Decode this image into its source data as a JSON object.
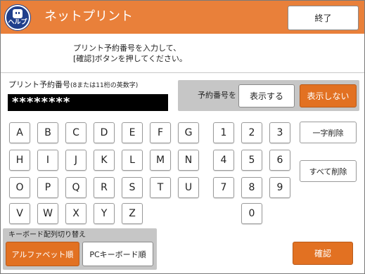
{
  "header": {
    "help_label": "ヘルプ",
    "title": "ネットプリント",
    "end_label": "終了",
    "color": "#e9803a"
  },
  "instructions": {
    "line1": "プリント予約番号を入力して、",
    "line2": "[確認]ボタンを押してください。"
  },
  "number_field": {
    "label": "プリント予約番号",
    "hint": "(8または11桁の英数字)",
    "value": "********"
  },
  "visibility": {
    "label": "予約番号を",
    "show_label": "表示する",
    "hide_label": "表示しない",
    "selected": "表示しない"
  },
  "keys": {
    "letters": [
      "A",
      "B",
      "C",
      "D",
      "E",
      "F",
      "G",
      "H",
      "I",
      "J",
      "K",
      "L",
      "M",
      "N",
      "O",
      "P",
      "Q",
      "R",
      "S",
      "T",
      "U",
      "V",
      "W",
      "X",
      "Y",
      "Z"
    ],
    "digits": [
      "1",
      "2",
      "3",
      "4",
      "5",
      "6",
      "7",
      "8",
      "9",
      "0"
    ]
  },
  "side_buttons": {
    "delete_one": "一字削除",
    "delete_all": "すべて削除"
  },
  "keyboard_switch": {
    "title": "キーボード配列切り替え",
    "alphabet_label": "アルファベット順",
    "pc_label": "PCキーボード順",
    "selected": "アルファベット順"
  },
  "confirm_label": "確認",
  "accent_color": "#e27122"
}
